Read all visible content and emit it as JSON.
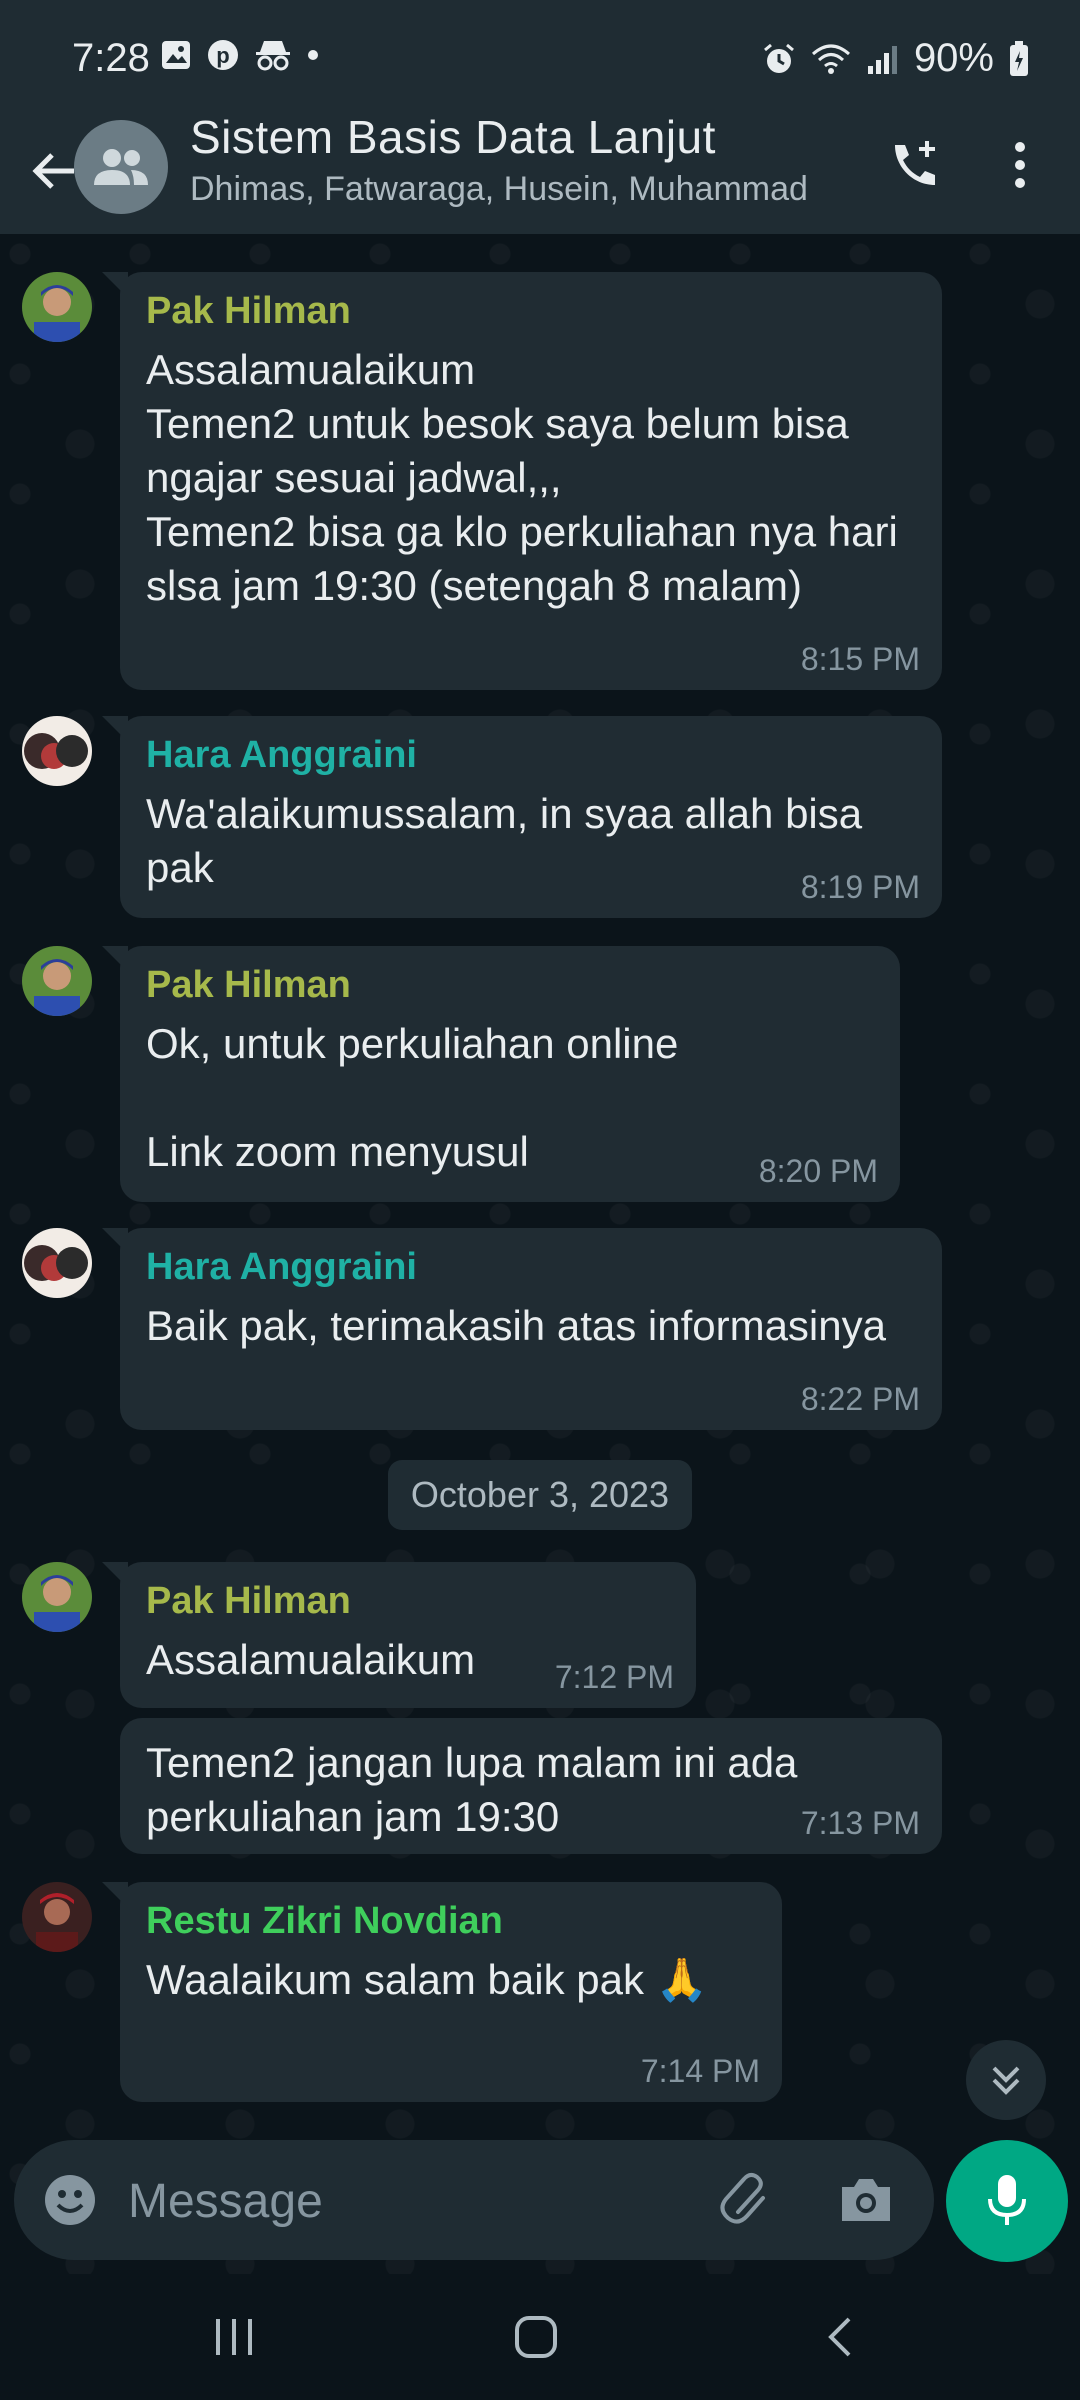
{
  "status_bar": {
    "time": "7:28",
    "battery": "90%",
    "left_icons": [
      "gallery-icon",
      "pinterest-icon",
      "incognito-icon",
      "dot-icon"
    ],
    "right_icons": [
      "alarm-icon",
      "wifi-icon",
      "signal-icon",
      "battery-icon"
    ]
  },
  "header": {
    "title": "Sistem Basis Data Lanjut",
    "subtitle": "Dhimas, Fatwaraga, Husein, Muhammad"
  },
  "colors": {
    "pak_hilman": "#a6b94b",
    "hara": "#1fb1a5",
    "restu": "#3fcf5c",
    "accent": "#00a884"
  },
  "messages": [
    {
      "sender": "Pak Hilman",
      "text": "Assalamualaikum\nTemen2 untuk besok saya belum bisa ngajar sesuai jadwal,,,\nTemen2 bisa ga klo perkuliahan nya hari slsa jam 19:30 (setengah 8 malam)",
      "time": "8:15 PM"
    },
    {
      "sender": "Hara Anggraini",
      "text": "Wa'alaikumussalam, in syaa allah bisa pak",
      "time": "8:19 PM"
    },
    {
      "sender": "Pak Hilman",
      "text": "Ok, untuk perkuliahan online\n\nLink zoom menyusul",
      "time": "8:20 PM"
    },
    {
      "sender": "Hara Anggraini",
      "text": "Baik pak, terimakasih atas informasinya",
      "time": "8:22 PM"
    },
    {
      "sender": "Pak Hilman",
      "text": "Assalamualaikum",
      "time": "7:12 PM"
    },
    {
      "sender": "",
      "text": "Temen2 jangan lupa malam ini ada perkuliahan jam 19:30",
      "time": "7:13 PM"
    },
    {
      "sender": "Restu Zikri Novdian",
      "text": "Waalaikum salam baik pak 🙏",
      "time": "7:14 PM"
    }
  ],
  "date_separator": "October 3, 2023",
  "composer": {
    "placeholder": "Message"
  }
}
